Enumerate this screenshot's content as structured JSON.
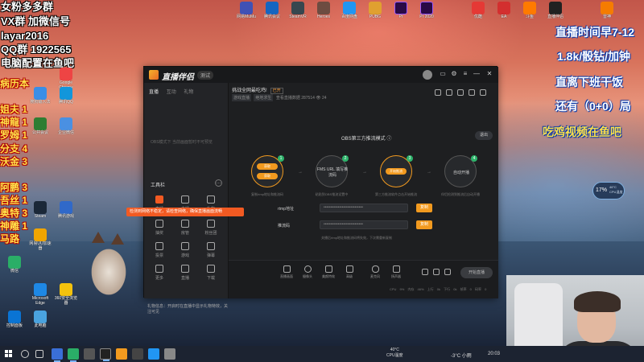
{
  "overlay": {
    "left_lines": [
      "女粉多多群",
      "VX群 加微信号",
      "layar2016",
      "QQ群 1922565",
      "电脑配置在鱼吧"
    ],
    "left_red": [
      "病历本",
      "姐夫 1",
      "神龍 1",
      "罗姆 1",
      "分支 4",
      "沃金 3",
      "阿鹏 3",
      "吾丝 1",
      "奥特 3",
      "神雕 1",
      "马路"
    ],
    "right_lines": [
      "直播时间早7-12",
      "1.8k/骰钻/加钟",
      "直离下班干饭",
      "还有（0+0）局",
      "吃鸡视频在鱼吧"
    ]
  },
  "desktop_icons_left": [
    "Google Chrome",
    "搜狗输入法",
    "腾讯QQ",
    "公共会议",
    "企业微信",
    "Steam",
    "腾讯游戏",
    "网易UU加速器",
    "微信",
    "Microsoft Edge",
    "360安全浏览器",
    "控制面板",
    "此电脑"
  ],
  "desktop_icons_top": [
    "网易MuMu",
    "腾讯会议",
    "SteamVR",
    "Heroes",
    "百度网盘",
    "PUBG",
    "Pr",
    "Pr 2020",
    "优酷",
    "EA",
    "斗鱼",
    "直播伴侣",
    "雷神"
  ],
  "app": {
    "name": "直播伴侣",
    "version": "测试",
    "left_tabs": [
      "直播",
      "互动",
      "礼物"
    ],
    "empty_hint": "OBS模式下 当前画面暂时不可预览",
    "tools_title": "工具栏",
    "tools": [
      {
        "label": "直播",
        "color": "#f25a22"
      },
      {
        "label": "主播"
      },
      {
        "label": "礼物"
      },
      {
        "label": "抽奖"
      },
      {
        "label": "房管"
      },
      {
        "label": "粉丝团"
      },
      {
        "label": "投票"
      },
      {
        "label": "游戏"
      },
      {
        "label": "弹幕"
      },
      {
        "label": "更多"
      },
      {
        "label": "直播"
      },
      {
        "label": "下载"
      }
    ],
    "notice": "礼物信息：开启时在直播中显示礼物特效，关注可见",
    "stream_title": "挑战全网最吃鸡!",
    "stream_tag": "已开",
    "stream_meta": [
      "游戏直播",
      "绝地求生"
    ],
    "stream_meta_extra": "查看直播数据  287514  👁 24",
    "obs_title": "OBS第三方推流模式 ⓘ",
    "exit_label": "退出",
    "steps": [
      {
        "num": "1",
        "text": "获取",
        "caption": "复制rtmp地址和推流码"
      },
      {
        "num": "2",
        "text": "FMS URL 填写推流码",
        "caption": "粘贴到OBS推流设置中"
      },
      {
        "num": "3",
        "text": "开始推流",
        "caption": "第三方推流软件点击开始推流"
      },
      {
        "num": "4",
        "text": "自动开播",
        "caption": "伴侣检测到推流后自动开播"
      }
    ],
    "rtmp_label": "rtmp地址",
    "rtmp_value": "••••••••••••••••••••••••••••",
    "key_label": "推流码",
    "key_value": "••••••••••••••••••••••••••••",
    "copy_label": "复制",
    "hint": "关播后rtmp地址和推流码将失效，下次需重新复制",
    "bottom_items": [
      "直播画面",
      "摄像头",
      "美颜特效",
      "高级",
      "麦克风",
      "扬声器"
    ],
    "start_label": "开始直播",
    "stats": "CPU 9%  内存 46%  上行 0k  下行 0k  帧率 0  码率 0",
    "tooltip": "检测到网络不稳定，请检查网络，确保直播画面流畅"
  },
  "cpu_widget": {
    "percent": "17%",
    "temp": "46°C",
    "label": "CPU温度"
  },
  "taskbar": {
    "cpu": "40°C",
    "cpu_label": "CPU温度",
    "weather": "-3°C 小雨",
    "time": "20:03"
  },
  "colors": {
    "accent": "#f29a1f",
    "green": "#2db46b",
    "tooltip": "#f25a22"
  }
}
